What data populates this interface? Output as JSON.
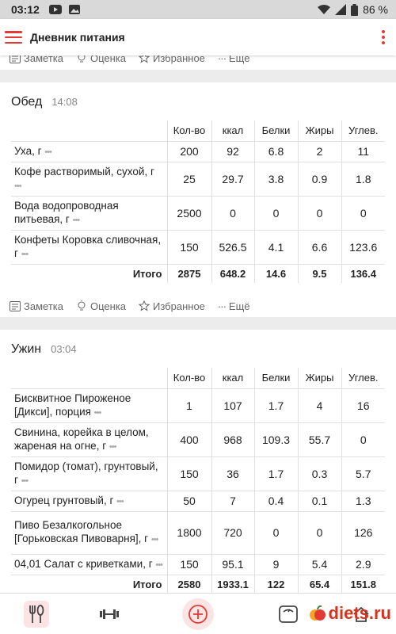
{
  "status_bar": {
    "time": "03:12",
    "battery": "86 %"
  },
  "app_bar": {
    "title": "Дневник питания"
  },
  "actions": {
    "note": "Заметка",
    "rate": "Оценка",
    "favorite": "Избранное",
    "more": "Ещё"
  },
  "columns": {
    "qty": "Кол-во",
    "kcal": "ккал",
    "protein": "Белки",
    "fat": "Жиры",
    "carbs": "Углев."
  },
  "lunch": {
    "title": "Обед",
    "time": "14:08",
    "items": [
      {
        "name": "Уха, г",
        "qty": "200",
        "kcal": "92",
        "protein": "6.8",
        "fat": "2",
        "carbs": "11"
      },
      {
        "name": "Кофе растворимый, сухой, г",
        "qty": "25",
        "kcal": "29.7",
        "protein": "3.8",
        "fat": "0.9",
        "carbs": "1.8"
      },
      {
        "name": "Вода водопроводная питьевая, г",
        "qty": "2500",
        "kcal": "0",
        "protein": "0",
        "fat": "0",
        "carbs": "0"
      },
      {
        "name": "Конфеты Коровка сливочная, г",
        "qty": "150",
        "kcal": "526.5",
        "protein": "4.1",
        "fat": "6.6",
        "carbs": "123.6"
      }
    ],
    "total": {
      "label": "Итого",
      "qty": "2875",
      "kcal": "648.2",
      "protein": "14.6",
      "fat": "9.5",
      "carbs": "136.4"
    }
  },
  "dinner": {
    "title": "Ужин",
    "time": "03:04",
    "items": [
      {
        "name": "Бисквитное Пироженое [Дикси], порция",
        "qty": "1",
        "kcal": "107",
        "protein": "1.7",
        "fat": "4",
        "carbs": "16"
      },
      {
        "name": "Свинина, корейка в целом, жареная на огне, г",
        "qty": "400",
        "kcal": "968",
        "protein": "109.3",
        "fat": "55.7",
        "carbs": "0"
      },
      {
        "name": "Помидор (томат), грунтовый, г",
        "qty": "150",
        "kcal": "36",
        "protein": "1.7",
        "fat": "0.3",
        "carbs": "5.7"
      },
      {
        "name": "Огурец грунтовый, г",
        "qty": "50",
        "kcal": "7",
        "protein": "0.4",
        "fat": "0.1",
        "carbs": "1.3"
      },
      {
        "name": "Пиво Безалкогольное [Горьковская Пивоварня], г",
        "qty": "1800",
        "kcal": "720",
        "protein": "0",
        "fat": "0",
        "carbs": "126"
      },
      {
        "name": "04,01 Салат с криветками, г",
        "qty": "150",
        "kcal": "95.1",
        "protein": "9",
        "fat": "5.4",
        "carbs": "2.9"
      }
    ],
    "total": {
      "label": "Итого",
      "qty": "2580",
      "kcal": "1933.1",
      "protein": "122",
      "fat": "65.4",
      "carbs": "151.8"
    }
  },
  "watermark": {
    "text": "diets.ru"
  },
  "colors": {
    "accent": "#e53935",
    "active_bg": "#fde3e3"
  },
  "icons": [
    "hamburger-icon",
    "kebab-icon",
    "note-icon",
    "lightbulb-icon",
    "star-icon",
    "dots-icon",
    "cutlery-icon",
    "dumbbell-icon",
    "add-icon",
    "scale-icon",
    "home-icon"
  ]
}
